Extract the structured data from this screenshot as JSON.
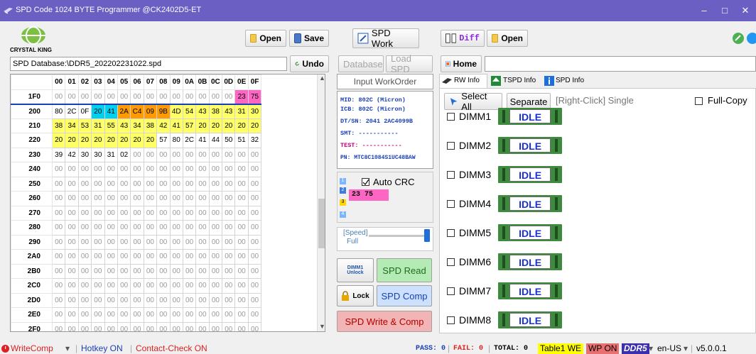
{
  "window": {
    "title": "SPD Code 1024 BYTE Programmer @CK2402D5-ET",
    "minimize": "–",
    "maximize": "□",
    "close": "✕"
  },
  "brand": {
    "name": "CRYSTAL KING"
  },
  "toolbar": {
    "open1": "Open",
    "save": "Save",
    "spd_work": "SPD Work",
    "diff": "Diff",
    "open2": "Open",
    "undo": "Undo",
    "database": "Database",
    "load_spd": "Load SPD",
    "home": "Home",
    "path": "SPD Database:\\DDR5_202202231022.spd"
  },
  "grid": {
    "columns": [
      "00",
      "01",
      "02",
      "03",
      "04",
      "05",
      "06",
      "07",
      "08",
      "09",
      "0A",
      "0B",
      "0C",
      "0D",
      "0E",
      "0F"
    ],
    "rows": [
      {
        "addr": "1F0",
        "cells": [
          "00",
          "00",
          "00",
          "00",
          "00",
          "00",
          "00",
          "00",
          "00",
          "00",
          "00",
          "00",
          "00",
          "00",
          "23",
          "75"
        ]
      },
      {
        "addr": "200",
        "cells": [
          "80",
          "2C",
          "0F",
          "20",
          "41",
          "2A",
          "C4",
          "09",
          "9B",
          "4D",
          "54",
          "43",
          "38",
          "43",
          "31",
          "30"
        ]
      },
      {
        "addr": "210",
        "cells": [
          "38",
          "34",
          "53",
          "31",
          "55",
          "43",
          "34",
          "38",
          "42",
          "41",
          "57",
          "20",
          "20",
          "20",
          "20",
          "20"
        ]
      },
      {
        "addr": "220",
        "cells": [
          "20",
          "20",
          "20",
          "20",
          "20",
          "20",
          "20",
          "20",
          "57",
          "80",
          "2C",
          "41",
          "44",
          "50",
          "41",
          "51",
          "32"
        ]
      },
      {
        "addr": "230",
        "cells": [
          "39",
          "42",
          "30",
          "30",
          "31",
          "02",
          "00",
          "00",
          "00",
          "00",
          "00",
          "00",
          "00",
          "00",
          "00",
          "00"
        ]
      },
      {
        "addr": "240",
        "cells": [
          "00",
          "00",
          "00",
          "00",
          "00",
          "00",
          "00",
          "00",
          "00",
          "00",
          "00",
          "00",
          "00",
          "00",
          "00",
          "00"
        ]
      },
      {
        "addr": "250",
        "cells": [
          "00",
          "00",
          "00",
          "00",
          "00",
          "00",
          "00",
          "00",
          "00",
          "00",
          "00",
          "00",
          "00",
          "00",
          "00",
          "00"
        ]
      },
      {
        "addr": "260",
        "cells": [
          "00",
          "00",
          "00",
          "00",
          "00",
          "00",
          "00",
          "00",
          "00",
          "00",
          "00",
          "00",
          "00",
          "00",
          "00",
          "00"
        ]
      },
      {
        "addr": "270",
        "cells": [
          "00",
          "00",
          "00",
          "00",
          "00",
          "00",
          "00",
          "00",
          "00",
          "00",
          "00",
          "00",
          "00",
          "00",
          "00",
          "00"
        ]
      },
      {
        "addr": "280",
        "cells": [
          "00",
          "00",
          "00",
          "00",
          "00",
          "00",
          "00",
          "00",
          "00",
          "00",
          "00",
          "00",
          "00",
          "00",
          "00",
          "00"
        ]
      },
      {
        "addr": "290",
        "cells": [
          "00",
          "00",
          "00",
          "00",
          "00",
          "00",
          "00",
          "00",
          "00",
          "00",
          "00",
          "00",
          "00",
          "00",
          "00",
          "00"
        ]
      },
      {
        "addr": "2A0",
        "cells": [
          "00",
          "00",
          "00",
          "00",
          "00",
          "00",
          "00",
          "00",
          "00",
          "00",
          "00",
          "00",
          "00",
          "00",
          "00",
          "00"
        ]
      },
      {
        "addr": "2B0",
        "cells": [
          "00",
          "00",
          "00",
          "00",
          "00",
          "00",
          "00",
          "00",
          "00",
          "00",
          "00",
          "00",
          "00",
          "00",
          "00",
          "00"
        ]
      },
      {
        "addr": "2C0",
        "cells": [
          "00",
          "00",
          "00",
          "00",
          "00",
          "00",
          "00",
          "00",
          "00",
          "00",
          "00",
          "00",
          "00",
          "00",
          "00",
          "00"
        ]
      },
      {
        "addr": "2D0",
        "cells": [
          "00",
          "00",
          "00",
          "00",
          "00",
          "00",
          "00",
          "00",
          "00",
          "00",
          "00",
          "00",
          "00",
          "00",
          "00",
          "00"
        ]
      },
      {
        "addr": "2E0",
        "cells": [
          "00",
          "00",
          "00",
          "00",
          "00",
          "00",
          "00",
          "00",
          "00",
          "00",
          "00",
          "00",
          "00",
          "00",
          "00",
          "00"
        ]
      },
      {
        "addr": "2F0",
        "cells": [
          "00",
          "00",
          "00",
          "00",
          "00",
          "00",
          "00",
          "00",
          "00",
          "00",
          "00",
          "00",
          "00",
          "00",
          "00",
          "00"
        ]
      },
      {
        "addr": "300",
        "cells": [
          "00",
          "00",
          "00",
          "00",
          "00",
          "00",
          "00",
          "00",
          "00",
          "00",
          "00",
          "00",
          "00",
          "00",
          "00",
          "00"
        ]
      }
    ]
  },
  "info": {
    "input_workorder": "Input WorkOrder",
    "mid": "MID:  802C (Micron)",
    "icb": "ICB:  802C (Micron)",
    "dtsn": "DT/SN: 2041 2AC4099B",
    "smt": "SMT:  -----------",
    "test": "TEST: -----------",
    "pn": "PN: MTC8C1084S1UC48BAW"
  },
  "crc": {
    "label": "Auto CRC",
    "value": "23  75",
    "slots": [
      "1",
      "2",
      "3",
      "4"
    ]
  },
  "speed": {
    "label": "[Speed]",
    "value": "Full"
  },
  "buttons": {
    "dimm_unlock_top": "DIMM1",
    "dimm_unlock_bottom": "Unlock",
    "spd_read": "SPD Read",
    "lock": "Lock",
    "spd_comp": "SPD Comp",
    "spd_write_comp": "SPD Write & Comp"
  },
  "tabs": {
    "rw_info": "RW Info",
    "tspd_info": "TSPD Info",
    "spd_info": "SPD Info"
  },
  "selection": {
    "select_all": "Select All",
    "separate": "Separate",
    "hint": "[Right-Click] Single",
    "full_copy": "Full-Copy"
  },
  "dimms": [
    {
      "label": "DIMM1",
      "state": "IDLE"
    },
    {
      "label": "DIMM2",
      "state": "IDLE"
    },
    {
      "label": "DIMM3",
      "state": "IDLE"
    },
    {
      "label": "DIMM4",
      "state": "IDLE"
    },
    {
      "label": "DIMM5",
      "state": "IDLE"
    },
    {
      "label": "DIMM6",
      "state": "IDLE"
    },
    {
      "label": "DIMM7",
      "state": "IDLE"
    },
    {
      "label": "DIMM8",
      "state": "IDLE"
    }
  ],
  "status": {
    "writecomp": "WriteComp",
    "hotkey": "Hotkey ON",
    "contact": "Contact-Check ON",
    "pass": "PASS: 0",
    "fail": "FAIL: 0",
    "total": "TOTAL: 0",
    "table1": "Table1 WE",
    "wp": "WP ON",
    "ddr": "DDR5",
    "lang": "en-US",
    "version": "v5.0.0.1"
  }
}
